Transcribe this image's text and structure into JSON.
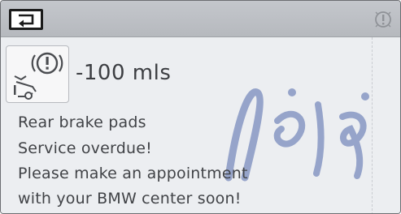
{
  "header": {
    "back_icon": "return-arrow-icon",
    "info_icon": "info-icon"
  },
  "warning": {
    "icon": "brake-pad-service-icon",
    "distance": "-100 mls",
    "lines": [
      "Rear brake pads",
      "Service overdue!",
      "Please make an appointment",
      "with your BMW center soon!"
    ]
  },
  "colors": {
    "topbar": "#bcbfc4",
    "background": "#eceef1",
    "text": "#414347",
    "watermark": "#2f4b9c"
  }
}
